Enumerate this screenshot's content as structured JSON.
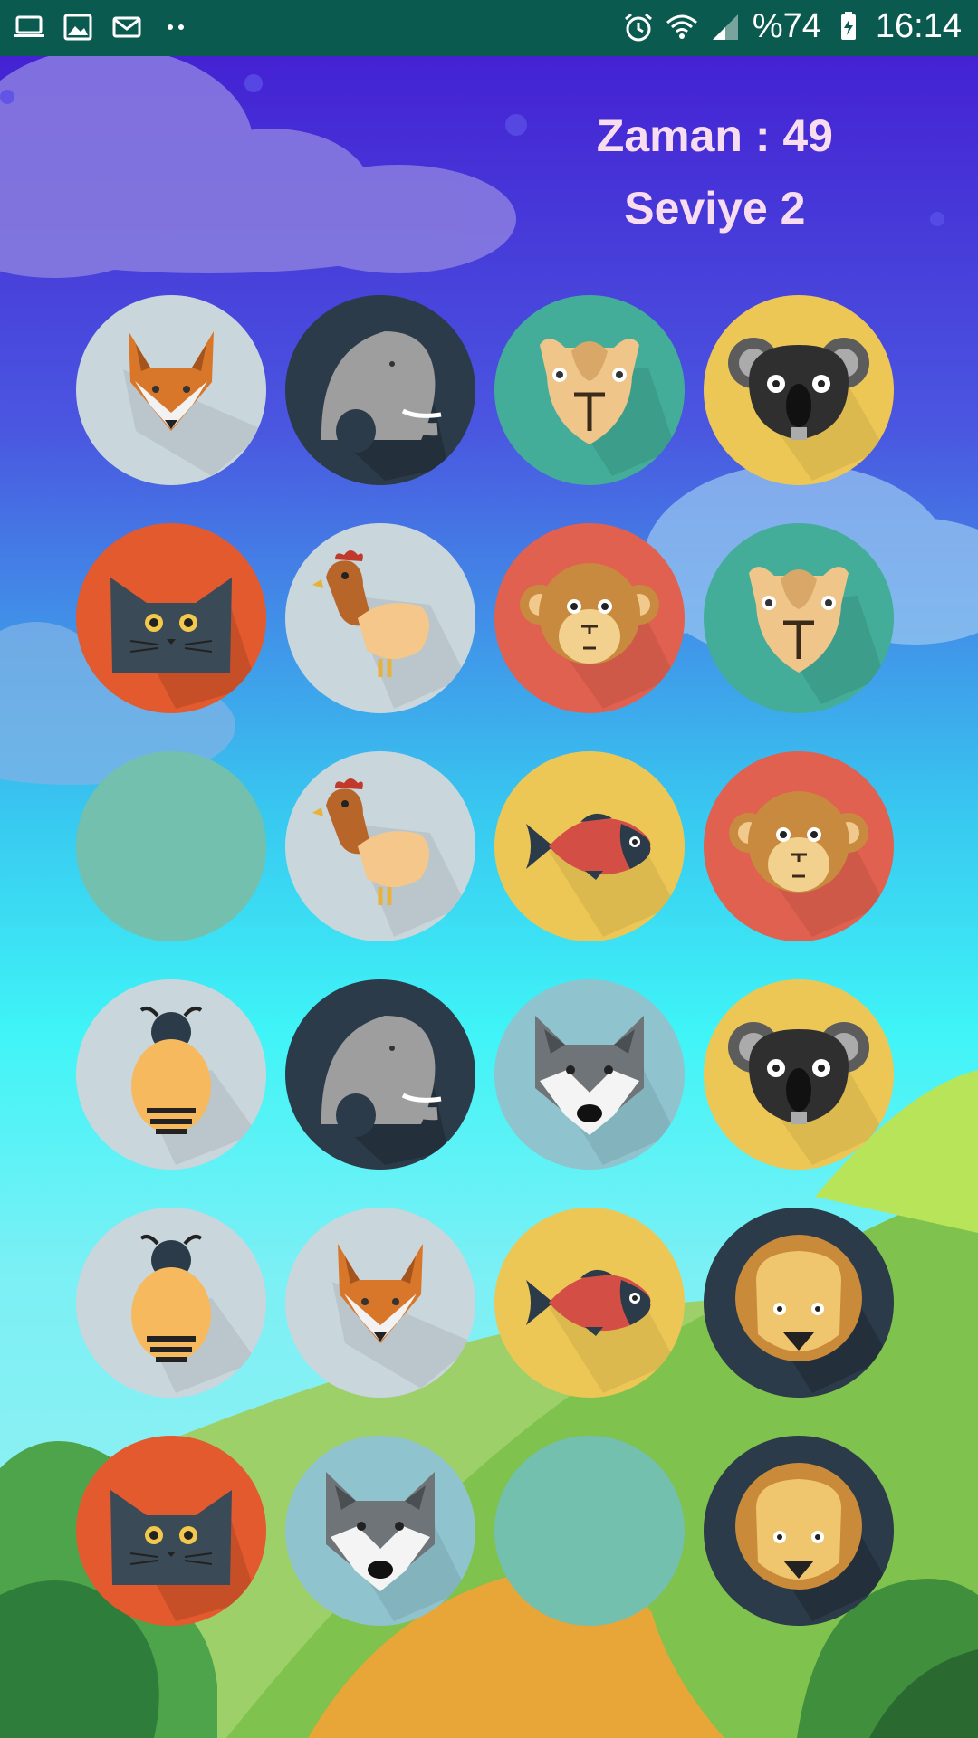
{
  "status_bar": {
    "battery": "%74",
    "time": "16:14",
    "left_icons": [
      "laptop-icon",
      "image-icon",
      "mail-icon",
      "more-dots-icon"
    ],
    "right_icons": [
      "alarm-icon",
      "wifi-icon",
      "signal-icon",
      "battery-charging-icon"
    ]
  },
  "hud": {
    "timer": "Zaman : 49",
    "level": "Seviye 2"
  },
  "grid": {
    "rows": 6,
    "cols": 4,
    "tiles": [
      [
        "fox",
        "elephant",
        "camel",
        "koala"
      ],
      [
        "cat",
        "chicken",
        "monkey",
        "camel"
      ],
      [
        "hidden",
        "chicken",
        "fish",
        "monkey"
      ],
      [
        "bee",
        "elephant",
        "wolf",
        "koala"
      ],
      [
        "bee",
        "fox",
        "fish",
        "lion"
      ],
      [
        "cat",
        "wolf",
        "hidden",
        "lion"
      ]
    ]
  },
  "colors": {
    "status_bar": "#0b5a4f",
    "hud_text": "#f8dcef",
    "hidden_tile": "#73c0ae"
  }
}
